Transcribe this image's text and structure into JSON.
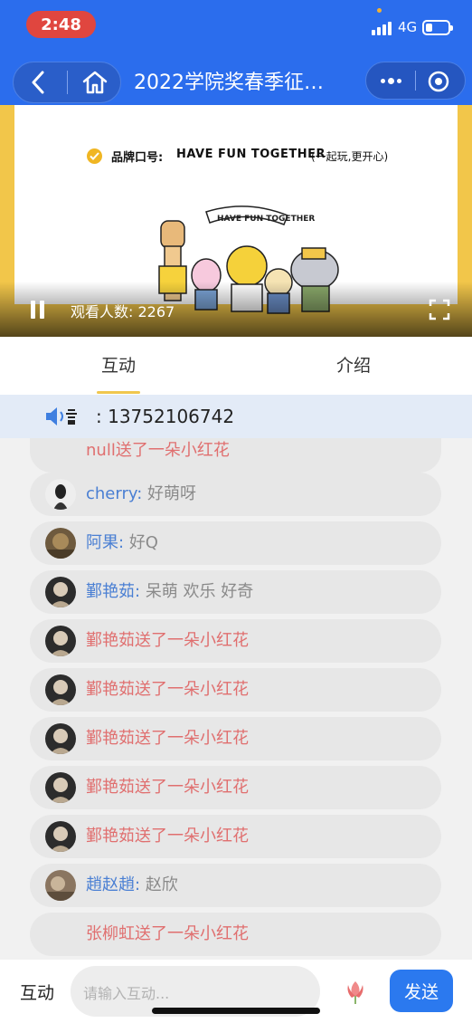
{
  "status_bar": {
    "time": "2:48",
    "network": "4G"
  },
  "nav": {
    "title": "2022学院奖春季征…"
  },
  "video": {
    "slogan_label": "品牌口号:",
    "slogan_text": "HAVE  FUN  TOGETHER",
    "slogan_sub": "(一起玩,更开心)",
    "viewers_label": "观看人数: 2267"
  },
  "tabs": [
    {
      "label": "互动",
      "active": true
    },
    {
      "label": "介绍",
      "active": false
    }
  ],
  "announcement": {
    "text": ": 13752106742"
  },
  "messages": [
    {
      "type": "gift",
      "text": "null送了一朵小红花",
      "avatar": false
    },
    {
      "type": "chat",
      "name": "cherry",
      "colon": ":",
      "content": "好萌呀",
      "avatar": true
    },
    {
      "type": "chat",
      "name": "阿果",
      "colon": ":",
      "content": "好Q",
      "avatar": true
    },
    {
      "type": "chat",
      "name": "鄞艳茹",
      "colon": ":",
      "content": "呆萌 欢乐 好奇",
      "avatar": true
    },
    {
      "type": "gift",
      "text": "鄞艳茹送了一朵小红花",
      "avatar": true
    },
    {
      "type": "gift",
      "text": "鄞艳茹送了一朵小红花",
      "avatar": true
    },
    {
      "type": "gift",
      "text": "鄞艳茹送了一朵小红花",
      "avatar": true
    },
    {
      "type": "gift",
      "text": "鄞艳茹送了一朵小红花",
      "avatar": true
    },
    {
      "type": "gift",
      "text": "鄞艳茹送了一朵小红花",
      "avatar": true
    },
    {
      "type": "chat",
      "name": "趙赵趙",
      "colon": ":",
      "content": "赵欣",
      "avatar": true
    },
    {
      "type": "gift",
      "text": "张柳虹送了一朵小红花",
      "avatar": false
    }
  ],
  "input_bar": {
    "label": "互动",
    "placeholder": "请输入互动...",
    "send_label": "发送"
  },
  "colors": {
    "brand_blue": "#2b6ded",
    "gift_red": "#e06f6f",
    "name_blue": "#4a7fd3",
    "accent_yellow": "#f0c74e"
  }
}
